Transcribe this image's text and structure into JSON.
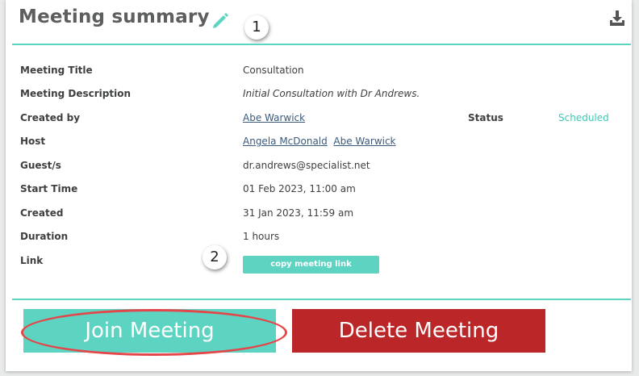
{
  "header": {
    "title": "Meeting summary",
    "edit_icon": "pencil-icon",
    "download_icon": "download-icon"
  },
  "callouts": [
    "1",
    "2"
  ],
  "details": {
    "meeting_title_label": "Meeting Title",
    "meeting_title_value": "Consultation",
    "meeting_description_label": "Meeting Description",
    "meeting_description_value": "Initial Consultation with Dr Andrews.",
    "created_by_label": "Created by",
    "created_by_value": "Abe Warwick",
    "status_label": "Status",
    "status_value": "Scheduled",
    "host_label": "Host",
    "host_values": [
      "Angela McDonald",
      "Abe Warwick"
    ],
    "guests_label": "Guest/s",
    "guests_value": "dr.andrews@specialist.net",
    "start_time_label": "Start Time",
    "start_time_value": "01 Feb 2023, 11:00 am",
    "created_label": "Created",
    "created_value": "31 Jan 2023, 11:59 am",
    "duration_label": "Duration",
    "duration_value": "1 hours",
    "link_label": "Link",
    "copy_link_label": "copy meeting link"
  },
  "actions": {
    "join_label": "Join Meeting",
    "delete_label": "Delete Meeting"
  },
  "colors": {
    "accent": "#5dd3c2",
    "danger": "#bb2628",
    "highlight": "#e4474a",
    "status": "#3ec9b3"
  }
}
